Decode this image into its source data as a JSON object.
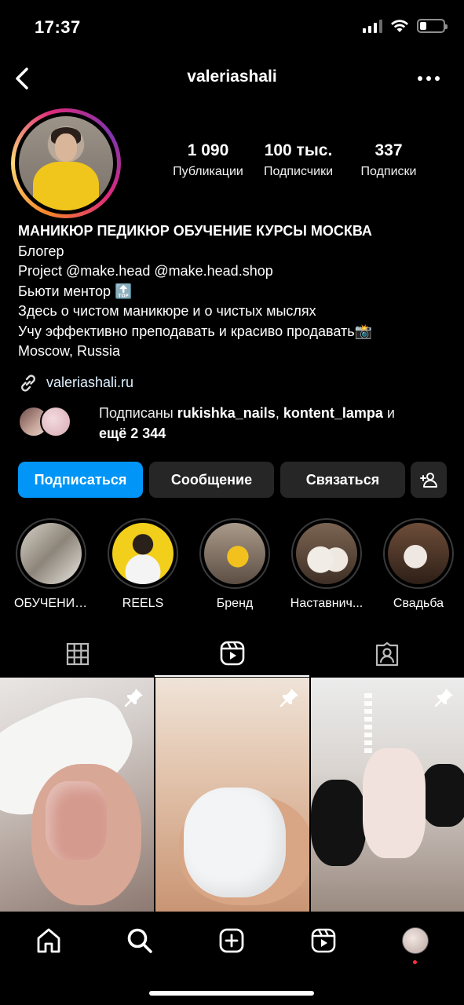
{
  "status_bar": {
    "time": "17:37",
    "battery_level": 0.3
  },
  "header": {
    "username": "valeriashali",
    "back_icon": "chevron-left-icon",
    "more_icon": "more-horizontal-icon"
  },
  "profile": {
    "stats": [
      {
        "value": "1 090",
        "label": "Публикации"
      },
      {
        "value": "100 тыс.",
        "label": "Подписчики"
      },
      {
        "value": "337",
        "label": "Подписки"
      }
    ],
    "name": "МАНИКЮР ПЕДИКЮР ОБУЧЕНИЕ КУРСЫ МОСКВА",
    "bio_lines": [
      "Блогер",
      "Project @make.head @make.head.shop",
      "Бьюти ментор 🔝",
      "Здесь о чистом маникюре и о чистых мыслях",
      "Учу эффективно преподавать и красиво продавать📸",
      "Moscow, Russia"
    ],
    "link": "valeriashali.ru",
    "followed_by": {
      "prefix": "Подписаны ",
      "user1": "rukishka_nails",
      "sep": ", ",
      "user2": "kontent_lampa",
      "suffix": " и",
      "more": "ещё 2 344"
    }
  },
  "actions": {
    "follow": "Подписаться",
    "message": "Сообщение",
    "contact": "Связаться",
    "add_person_icon": "add-person-icon"
  },
  "highlights": [
    {
      "label": "ОБУЧЕНИЕ..."
    },
    {
      "label": "REELS"
    },
    {
      "label": "Бренд"
    },
    {
      "label": "Наставнич..."
    },
    {
      "label": "Свадьба"
    }
  ],
  "tabs": [
    {
      "icon": "grid-icon"
    },
    {
      "icon": "reels-icon",
      "active": true
    },
    {
      "icon": "tagged-icon"
    }
  ],
  "posts": [
    {
      "pinned": true
    },
    {
      "pinned": true
    },
    {
      "pinned": true
    }
  ],
  "bottom_nav": [
    "home-icon",
    "search-icon",
    "create-icon",
    "reels-icon",
    "profile-avatar"
  ],
  "colors": {
    "accent": "#0095f6",
    "button": "#262626",
    "notification_dot": "#ff3040"
  }
}
